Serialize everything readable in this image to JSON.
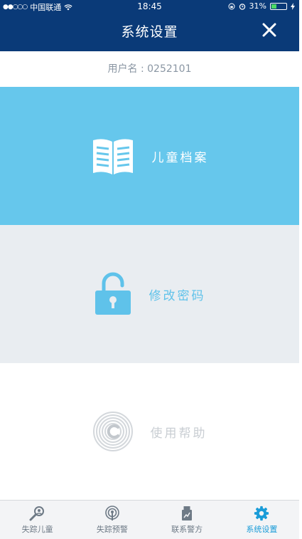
{
  "status_bar": {
    "carrier": "中国联通",
    "time": "18:45",
    "battery": "31%"
  },
  "header": {
    "title": "系统设置"
  },
  "user": {
    "label": "用户名 : 0252101"
  },
  "menu": [
    {
      "label": "儿童档案",
      "icon": "book-icon"
    },
    {
      "label": "修改密码",
      "icon": "unlock-icon"
    },
    {
      "label": "使用帮助",
      "icon": "fingerprint-icon"
    }
  ],
  "tabbar": [
    {
      "label": "失踪儿童",
      "icon": "search-person-icon"
    },
    {
      "label": "失踪预警",
      "icon": "broadcast-icon"
    },
    {
      "label": "联系警方",
      "icon": "police-icon"
    },
    {
      "label": "系统设置",
      "icon": "gear-icon",
      "active": true
    }
  ],
  "colors": {
    "header": "#0a3a78",
    "accent": "#66c7ec",
    "active_tab": "#1a9cd8"
  }
}
